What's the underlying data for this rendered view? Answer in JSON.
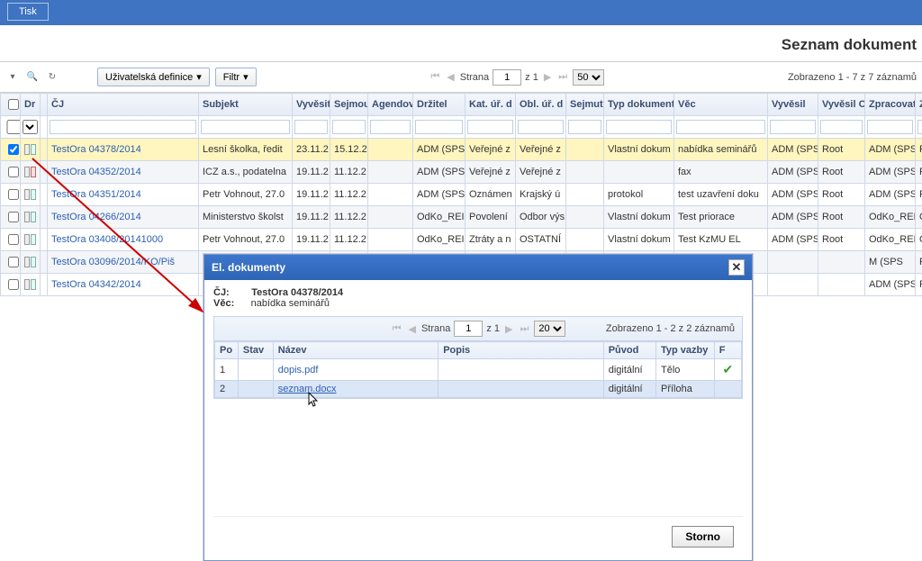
{
  "topbar": {
    "print_label": "Tisk"
  },
  "page_title": "Seznam dokument",
  "toolbar": {
    "userdef_label": "Uživatelská definice",
    "filter_label": "Filtr"
  },
  "pager_main": {
    "strana_label": "Strana",
    "page": "1",
    "of_label": "z 1",
    "pagesize": "50",
    "records": "Zobrazeno 1 - 7 z 7 záznamů"
  },
  "columns": [
    "",
    "Dr",
    "",
    "ČJ",
    "Subjekt",
    "Vyvěsit",
    "Sejmou",
    "Agendové",
    "Držitel",
    "Kat. úř. d",
    "Obl. úř. d",
    "Sejmut",
    "Typ dokument",
    "Věc",
    "Vyvěsil",
    "Vyvěsil O.",
    "Zpracovat",
    "Zpracova"
  ],
  "rows": [
    {
      "selected": true,
      "dr_red": false,
      "cj": "TestOra 04378/2014",
      "subjekt": "Lesní školka, ředit",
      "vyvesit": "23.11.2",
      "sejmou": "15.12.2",
      "agenda": "",
      "drzitel": "ADM (SPS",
      "kat": "Veřejné z",
      "obl": "Veřejné z",
      "sejmut": "",
      "typ": "Vlastní dokum",
      "vec": "nabídka seminářů",
      "vyvesil": "ADM (SPS",
      "vyvesilo": "Root",
      "zprac": "ADM (SPS",
      "zprac2": "Root"
    },
    {
      "selected": false,
      "dr_red": true,
      "cj": "TestOra 04352/2014",
      "subjekt": "ICZ a.s., podatelna",
      "vyvesit": "19.11.2",
      "sejmou": "11.12.2",
      "agenda": "",
      "drzitel": "ADM (SPS",
      "kat": "Veřejné z",
      "obl": "Veřejné z",
      "sejmut": "",
      "typ": "",
      "vec": "fax",
      "vyvesil": "ADM (SPS",
      "vyvesilo": "Root",
      "zprac": "ADM (SPS",
      "zprac2": "Root"
    },
    {
      "selected": false,
      "dr_red": false,
      "cj": "TestOra 04351/2014",
      "subjekt": "Petr Vohnout, 27.0",
      "vyvesit": "19.11.2",
      "sejmou": "11.12.2",
      "agenda": "",
      "drzitel": "ADM (SPS",
      "kat": "Oznámen",
      "obl": "Krajský ú",
      "sejmut": "",
      "typ": "protokol",
      "vec": "test uzavření doku",
      "vyvesil": "ADM (SPS",
      "vyvesilo": "Root",
      "zprac": "ADM (SPS",
      "zprac2": "Root"
    },
    {
      "selected": false,
      "dr_red": false,
      "cj": "TestOra 04266/2014",
      "subjekt": "Ministerstvo školst",
      "vyvesit": "19.11.2",
      "sejmou": "11.12.2",
      "agenda": "",
      "drzitel": "OdKo_REI",
      "kat": "Povolení",
      "obl": "Odbor výs",
      "sejmut": "",
      "typ": "Vlastní dokum",
      "vec": "Test priorace",
      "vyvesil": "ADM (SPS",
      "vyvesilo": "Root",
      "zprac": "OdKo_REI",
      "zprac2": "Oddělení"
    },
    {
      "selected": false,
      "dr_red": false,
      "cj": "TestOra 03408/20141000",
      "subjekt": "Petr Vohnout, 27.0",
      "vyvesit": "19.11.2",
      "sejmou": "11.12.2",
      "agenda": "",
      "drzitel": "OdKo_REI",
      "kat": "Ztráty a n",
      "obl": "OSTATNÍ",
      "sejmut": "",
      "typ": "Vlastní dokum",
      "vec": "Test KzMU EL",
      "vyvesil": "ADM (SPS",
      "vyvesilo": "Root",
      "zprac": "OdKo_REI",
      "zprac2": "Oddělení"
    },
    {
      "selected": false,
      "dr_red": false,
      "cj": "TestOra 03096/2014/KO/Piš",
      "subjekt": "",
      "vyvesit": "",
      "sejmou": "",
      "agenda": "",
      "drzitel": "",
      "kat": "",
      "obl": "",
      "sejmut": "",
      "typ": "",
      "vec": "",
      "vyvesil": "",
      "vyvesilo": "",
      "zprac": "M (SPS",
      "zprac2": "Root"
    },
    {
      "selected": false,
      "dr_red": false,
      "cj": "TestOra 04342/2014",
      "subjekt": "",
      "vyvesit": "",
      "sejmou": "",
      "agenda": "",
      "drzitel": "",
      "kat": "",
      "obl": "",
      "sejmut": "",
      "typ": "",
      "vec": "",
      "vyvesil": "",
      "vyvesilo": "",
      "zprac": "ADM (SPS",
      "zprac2": "Root"
    }
  ],
  "dialog": {
    "title": "El. dokumenty",
    "meta_cj_label": "ČJ:",
    "meta_cj_value": "TestOra 04378/2014",
    "meta_vec_label": "Věc:",
    "meta_vec_value": "nabídka seminářů",
    "pager": {
      "strana_label": "Strana",
      "page": "1",
      "of_label": "z 1",
      "pagesize": "20",
      "records": "Zobrazeno 1 - 2 z 2 záznamů"
    },
    "columns": [
      "Po",
      "Stav",
      "Název",
      "Popis",
      "Původ",
      "Typ vazby",
      "F"
    ],
    "rows": [
      {
        "po": "1",
        "stav": "",
        "nazev": "dopis.pdf",
        "popis": "",
        "puvod": "digitální",
        "vazba": "Tělo",
        "f_check": true,
        "sel": false
      },
      {
        "po": "2",
        "stav": "",
        "nazev": "seznam.docx",
        "popis": "",
        "puvod": "digitální",
        "vazba": "Příloha",
        "f_check": false,
        "sel": true
      }
    ],
    "storno_label": "Storno"
  }
}
